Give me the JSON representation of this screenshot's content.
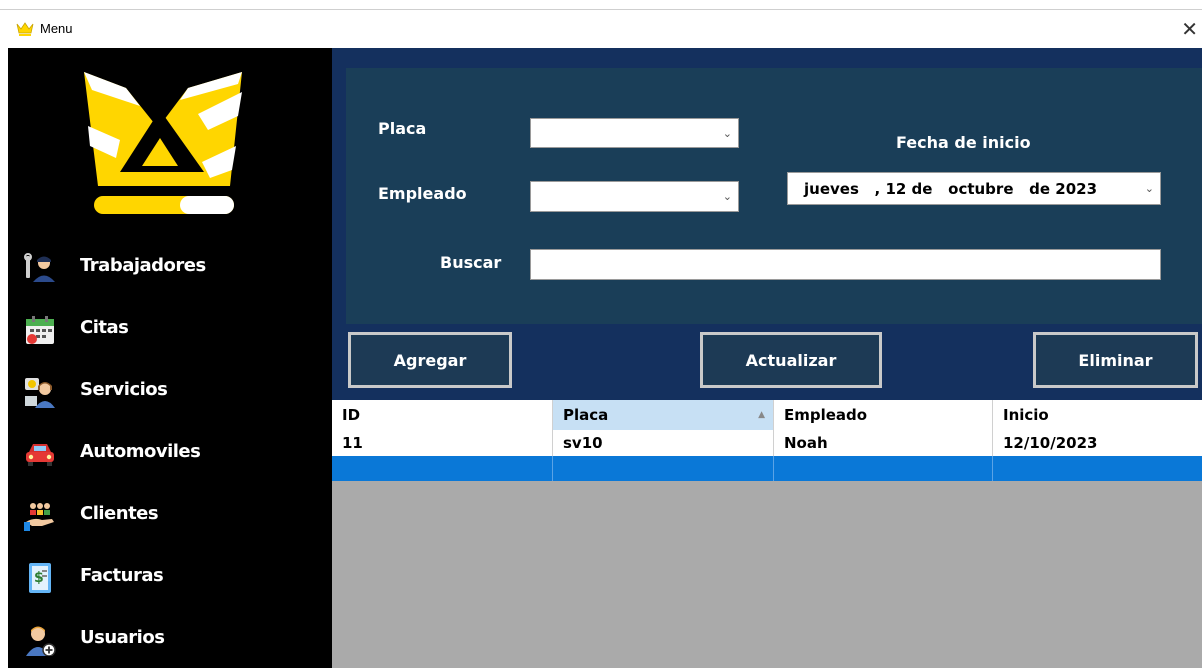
{
  "window": {
    "title": "Menu",
    "close_glyph": "✕",
    "icon": "crown-icon"
  },
  "sidebar": {
    "logo": "crown-logo",
    "items": [
      {
        "label": "Trabajadores",
        "icon": "mechanic-icon"
      },
      {
        "label": "Citas",
        "icon": "calendar-icon"
      },
      {
        "label": "Servicios",
        "icon": "support-agent-icon"
      },
      {
        "label": "Automoviles",
        "icon": "car-icon"
      },
      {
        "label": "Clientes",
        "icon": "customers-hand-icon"
      },
      {
        "label": "Facturas",
        "icon": "invoice-icon"
      },
      {
        "label": "Usuarios",
        "icon": "add-user-icon"
      }
    ]
  },
  "form": {
    "placa_label": "Placa",
    "placa_value": "",
    "empleado_label": "Empleado",
    "empleado_value": "",
    "fecha_label": "Fecha de inicio",
    "fecha_value": "jueves   , 12 de   octubre   de 2023",
    "buscar_label": "Buscar",
    "buscar_value": ""
  },
  "buttons": {
    "agregar": "Agregar",
    "actualizar": "Actualizar",
    "eliminar": "Eliminar"
  },
  "table": {
    "columns": [
      "ID",
      "Placa",
      "Empleado",
      "Inicio"
    ],
    "sorted_column": "Placa",
    "rows": [
      [
        "11",
        "sv10",
        "Noah",
        "12/10/2023"
      ]
    ]
  },
  "colors": {
    "sidebar_bg": "#000000",
    "top_band": "#14305e",
    "form_panel": "#1a3e58",
    "button_bg": "#1d3a55",
    "grid_bg": "#aaaaaa",
    "selected_row": "#0a78d7",
    "logo_yellow": "#ffd600"
  }
}
